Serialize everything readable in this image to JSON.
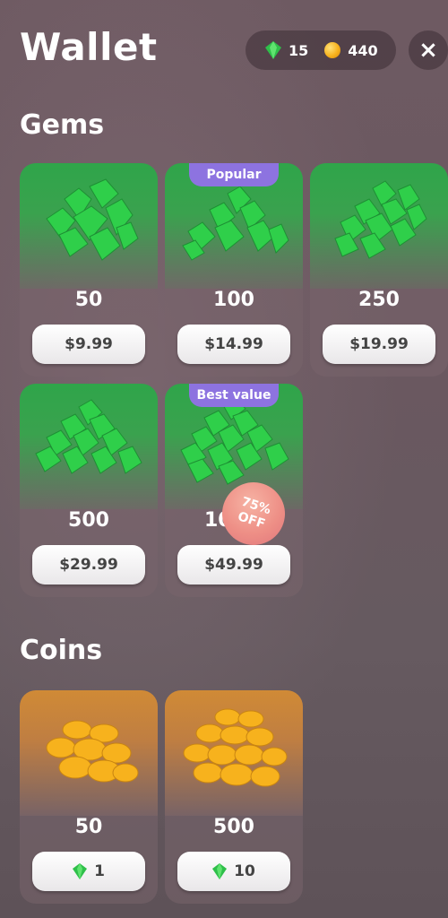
{
  "header": {
    "title": "Wallet",
    "gem_balance": "15",
    "coin_balance": "440",
    "close_icon": "×"
  },
  "gems_section": {
    "title": "Gems",
    "packs": [
      {
        "amount": "50",
        "price": "$9.99",
        "badge": ""
      },
      {
        "amount": "100",
        "price": "$14.99",
        "badge": "Popular"
      },
      {
        "amount": "250",
        "price": "$19.99",
        "badge": ""
      },
      {
        "amount": "500",
        "price": "$29.99",
        "badge": ""
      },
      {
        "amount": "1000",
        "amount_visible": "10",
        "price": "$49.99",
        "badge": "Best value",
        "discount_line1": "75%",
        "discount_line2": "OFF"
      }
    ]
  },
  "coins_section": {
    "title": "Coins",
    "packs": [
      {
        "amount": "50",
        "price_gems": "1"
      },
      {
        "amount": "500",
        "price_gems": "10"
      }
    ]
  },
  "colors": {
    "gem_green": "#2fbf4a",
    "coin_gold": "#f7b21d",
    "badge_purple": "#8d73e0",
    "discount_pink": "#ee8f86"
  },
  "icons": [
    "gem-icon",
    "coin-icon",
    "close-icon"
  ]
}
